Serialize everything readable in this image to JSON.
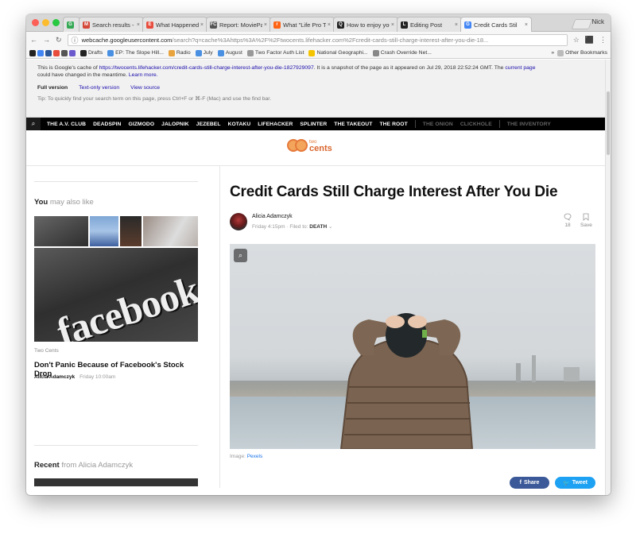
{
  "browser": {
    "user": "Nick",
    "tabs": [
      {
        "label": "",
        "color": "#35a853",
        "icon": "G"
      },
      {
        "label": "Search results -",
        "color": "#d44638",
        "icon": "M"
      },
      {
        "label": "What Happened",
        "color": "#e84c3d",
        "icon": "E"
      },
      {
        "label": "Report: MoviePa",
        "color": "#555555",
        "icon": "FC"
      },
      {
        "label": "What \"Life Pro Ti",
        "color": "#ff6314",
        "icon": "r"
      },
      {
        "label": "How to enjoy you",
        "color": "#222222",
        "icon": "Q"
      },
      {
        "label": "Editing Post",
        "color": "#222222",
        "icon": "L"
      },
      {
        "label": "Credit Cards Stil",
        "color": "#4285f4",
        "icon": "G"
      }
    ],
    "url_host": "webcache.googleusercontent.com",
    "url_path": "/search?q=cache%3Ahttps%3A%2F%2Ftwocents.lifehacker.com%2Fcredit-cards-still-charge-interest-after-you-die-18...",
    "bookmarks": [
      {
        "label": "Drafts",
        "color": "#222222"
      },
      {
        "label": "EP: The Slope Hill...",
        "color": "#4a90e2"
      },
      {
        "label": "Radio",
        "color": "#e8a33d"
      },
      {
        "label": "July",
        "color": "#4a90e2"
      },
      {
        "label": "August",
        "color": "#4a90e2"
      },
      {
        "label": "Two Factor Auth List",
        "color": "#999999"
      },
      {
        "label": "National Geographi...",
        "color": "#f5c400"
      },
      {
        "label": "Crash Override Net...",
        "color": "#888888"
      }
    ],
    "other_bookmarks": "Other Bookmarks"
  },
  "cache_notice": {
    "prefix": "This is Google's cache of",
    "link": "https://twocents.lifehacker.com/credit-cards-still-charge-interest-after-you-die-1827929097",
    "suffix": ". It is a snapshot of the page as it appeared on Jul 29, 2018 22:52:24 GMT. The",
    "current_page": "current page",
    "line2": "could have changed in the meantime.",
    "learn_more": "Learn more.",
    "full_version": "Full version",
    "text_only": "Text-only version",
    "view_source": "View source",
    "tip": "Tip: To quickly find your search term on this page, press Ctrl+F or ⌘-F (Mac) and use the find bar."
  },
  "site_nav": {
    "items": [
      "THE A.V. CLUB",
      "DEADSPIN",
      "GIZMODO",
      "JALOPNIK",
      "JEZEBEL",
      "KOTAKU",
      "LIFEHACKER",
      "SPLINTER",
      "THE TAKEOUT",
      "THE ROOT"
    ],
    "dim_items": [
      "THE ONION",
      "CLICKHOLE"
    ],
    "extra": "THE INVENTORY"
  },
  "logo": {
    "small": "two",
    "large": "cents"
  },
  "sidebar": {
    "also_like_bold": "You",
    "also_like_rest": " may also like",
    "featured_category": "Two Cents",
    "featured_title": "Don't Panic Because of Facebook's Stock Drop",
    "featured_author": "Alicia Adamczyk",
    "featured_time": "Friday 10:00am",
    "image_text": "facebook",
    "recent_bold": "Recent",
    "recent_rest": " from Alicia Adamczyk"
  },
  "article": {
    "title": "Credit Cards Still Charge Interest After You Die",
    "author": "Alicia Adamczyk",
    "date": "Friday 4:15pm",
    "filed_to_label": "Filed to:",
    "filed_to": "DEATH",
    "comment_count": "18",
    "save_label": "Save",
    "caption_label": "Image:",
    "caption_source": "Pexels"
  },
  "share": {
    "facebook": "Share",
    "twitter": "Tweet"
  }
}
